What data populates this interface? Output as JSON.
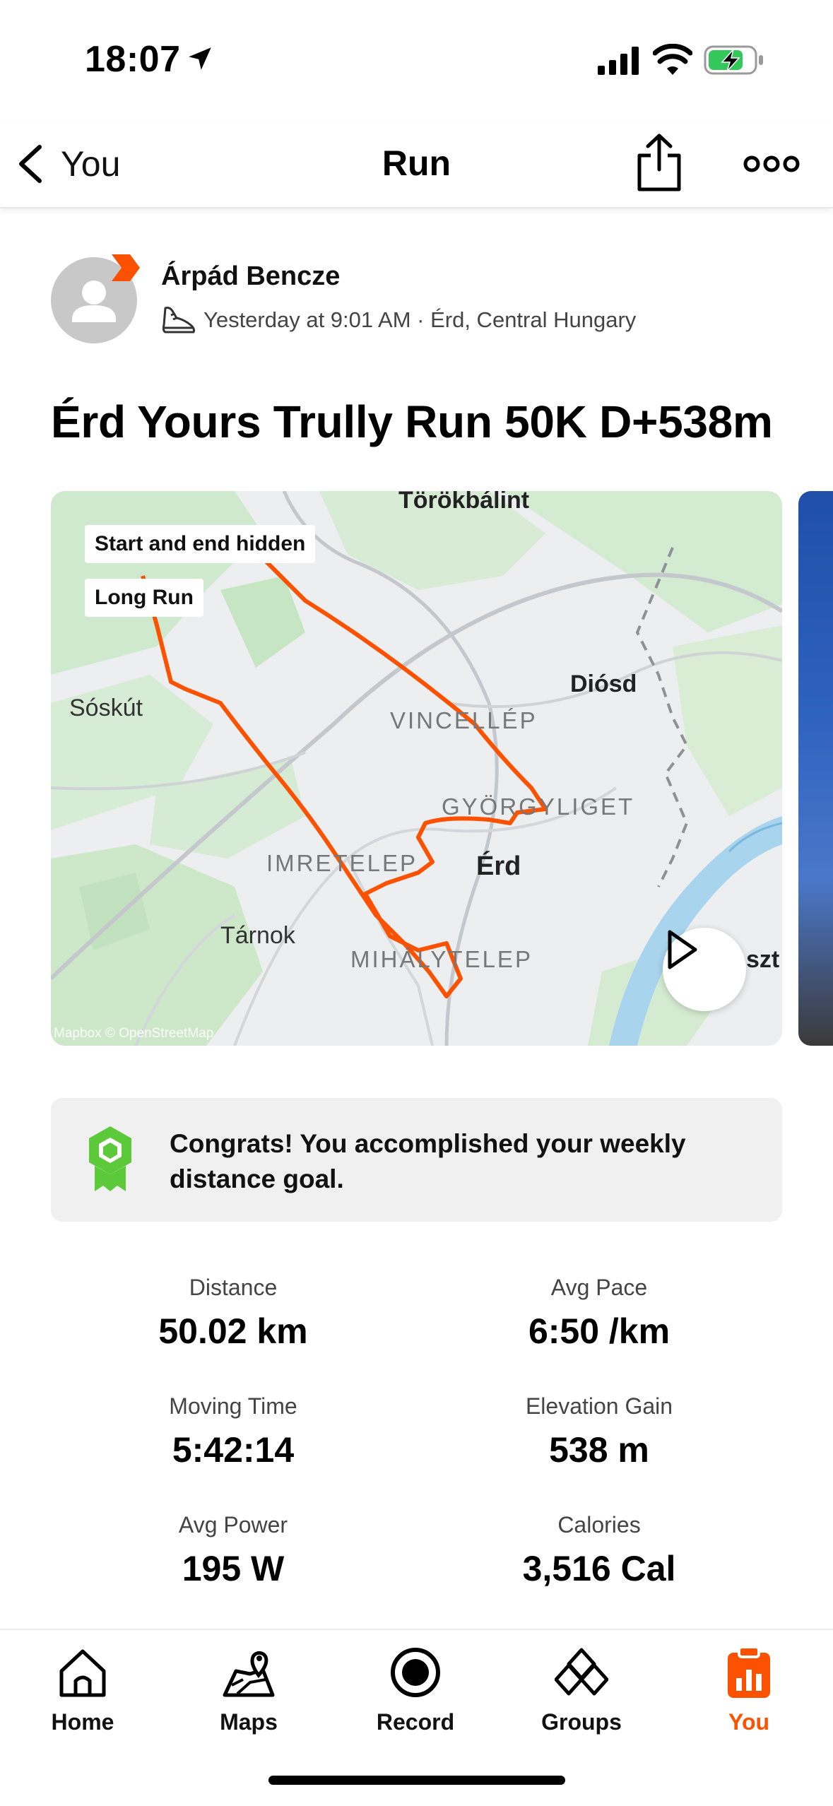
{
  "status_bar": {
    "time": "18:07"
  },
  "nav": {
    "back_label": "You",
    "title": "Run"
  },
  "athlete": {
    "name": "Árpád Bencze",
    "meta": "Yesterday at 9:01 AM · Érd, Central Hungary"
  },
  "activity": {
    "title": "Érd Yours Trully Run 50K D+538m"
  },
  "map": {
    "tags": {
      "hidden": "Start and end hidden",
      "workout_type": "Long Run"
    },
    "places": {
      "torokbalint": "Törökbálint",
      "soskut": "Sóskút",
      "diosd": "Diósd",
      "vincellep": "VINCELLÉP",
      "gyorgyliget": "GYÖRGYLIGET",
      "imretelep": "IMRETELEP",
      "erd": "Érd",
      "tarnok": "Tárnok",
      "mihalytelep": "MIHÁLYTELEP",
      "szt": "szt"
    },
    "credit": "Mapbox © OpenStreetMap",
    "route_color": "#fc5200"
  },
  "congrats": {
    "text": "Congrats! You accomplished your weekly distance goal."
  },
  "stats": {
    "distance": {
      "label": "Distance",
      "value": "50.02 km"
    },
    "avg_pace": {
      "label": "Avg Pace",
      "value": "6:50 /km"
    },
    "moving_time": {
      "label": "Moving Time",
      "value": "5:42:14"
    },
    "elevation_gain": {
      "label": "Elevation Gain",
      "value": "538 m"
    },
    "avg_power": {
      "label": "Avg Power",
      "value": "195 W"
    },
    "calories": {
      "label": "Calories",
      "value": "3,516 Cal"
    }
  },
  "tabs": [
    {
      "label": "Home",
      "icon": "home-icon"
    },
    {
      "label": "Maps",
      "icon": "maps-icon"
    },
    {
      "label": "Record",
      "icon": "record-icon"
    },
    {
      "label": "Groups",
      "icon": "groups-icon"
    },
    {
      "label": "You",
      "icon": "you-icon",
      "active": true
    }
  ],
  "colors": {
    "accent": "#fc5200",
    "goal_badge": "#5cc93a"
  }
}
